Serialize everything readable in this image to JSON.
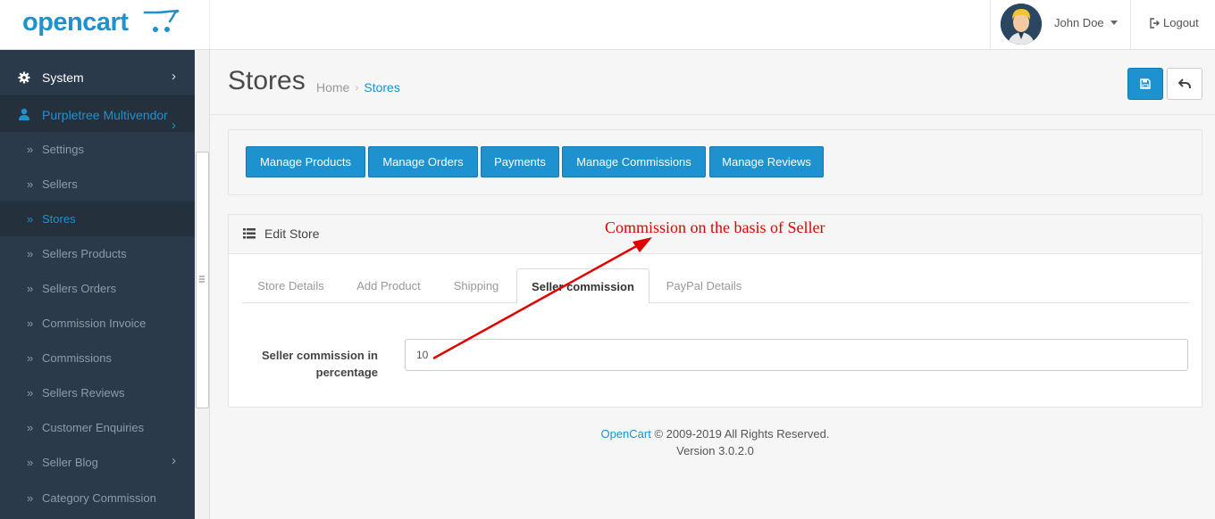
{
  "header": {
    "logo": "opencart",
    "user_name": "John Doe",
    "logout_label": "Logout"
  },
  "sidebar": {
    "system_label": "System",
    "vendor_label": "Purpletree Multivendor",
    "items": [
      {
        "label": "Settings"
      },
      {
        "label": "Sellers"
      },
      {
        "label": "Stores"
      },
      {
        "label": "Sellers Products"
      },
      {
        "label": "Sellers Orders"
      },
      {
        "label": "Commission Invoice"
      },
      {
        "label": "Commissions"
      },
      {
        "label": "Sellers Reviews"
      },
      {
        "label": "Customer Enquiries"
      },
      {
        "label": "Seller Blog"
      },
      {
        "label": "Category Commission"
      }
    ]
  },
  "page": {
    "title": "Stores",
    "breadcrumb": {
      "home": "Home",
      "current": "Stores"
    }
  },
  "buttons": {
    "manage_products": "Manage Products",
    "manage_orders": "Manage Orders",
    "payments": "Payments",
    "manage_commissions": "Manage Commissions",
    "manage_reviews": "Manage Reviews"
  },
  "panel": {
    "title": "Edit Store",
    "tabs": [
      {
        "label": "Store Details"
      },
      {
        "label": "Add Product"
      },
      {
        "label": "Shipping"
      },
      {
        "label": "Seller commission"
      },
      {
        "label": "PayPal Details"
      }
    ],
    "field_label_line1": "Seller commission in",
    "field_label_line2": "percentage",
    "field_value": "10"
  },
  "annotation": "Commission on the basis of Seller",
  "footer": {
    "link": "OpenCart",
    "copyright": " © 2009-2019 All Rights Reserved.",
    "version": "Version 3.0.2.0"
  },
  "colors": {
    "primary": "#1e91cf",
    "sidebar": "#2b3a4a",
    "annotation": "#e00000"
  }
}
